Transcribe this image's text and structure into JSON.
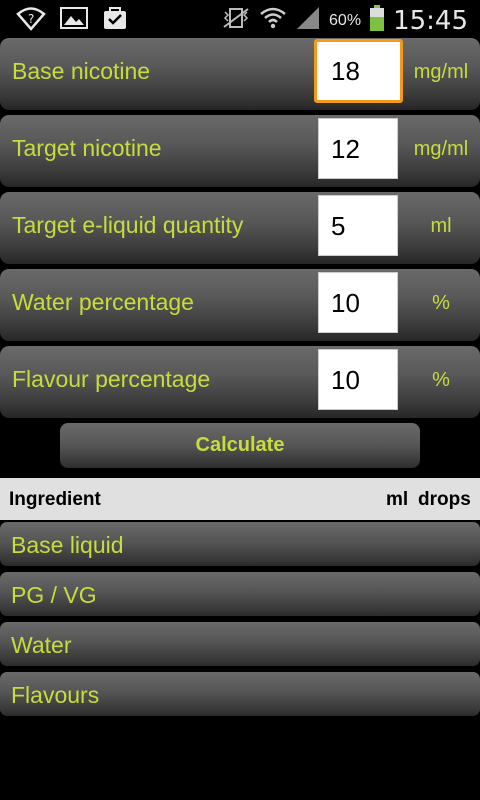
{
  "status_bar": {
    "battery_percent": "60%",
    "time": "15:45",
    "icons": [
      "wifi-question-icon",
      "image-icon",
      "checkbox-bag-icon",
      "vibrate-mute-icon",
      "wifi-icon",
      "signal-icon",
      "battery-icon"
    ]
  },
  "form": {
    "rows": [
      {
        "label": "Base nicotine",
        "value": "18",
        "unit": "mg/ml"
      },
      {
        "label": "Target nicotine",
        "value": "12",
        "unit": "mg/ml"
      },
      {
        "label": "Target e-liquid quantity",
        "value": "5",
        "unit": "ml"
      },
      {
        "label": "Water percentage",
        "value": "10",
        "unit": "%"
      },
      {
        "label": "Flavour percentage",
        "value": "10",
        "unit": "%"
      }
    ]
  },
  "calculate_label": "Calculate",
  "table": {
    "headers": {
      "ingredient": "Ingredient",
      "ml": "ml",
      "drops": "drops"
    },
    "rows": [
      {
        "label": "Base liquid"
      },
      {
        "label": "PG / VG"
      },
      {
        "label": "Water"
      },
      {
        "label": "Flavours"
      }
    ]
  },
  "colors": {
    "accent": "#c8dc3c",
    "focus": "#f39a1c"
  }
}
